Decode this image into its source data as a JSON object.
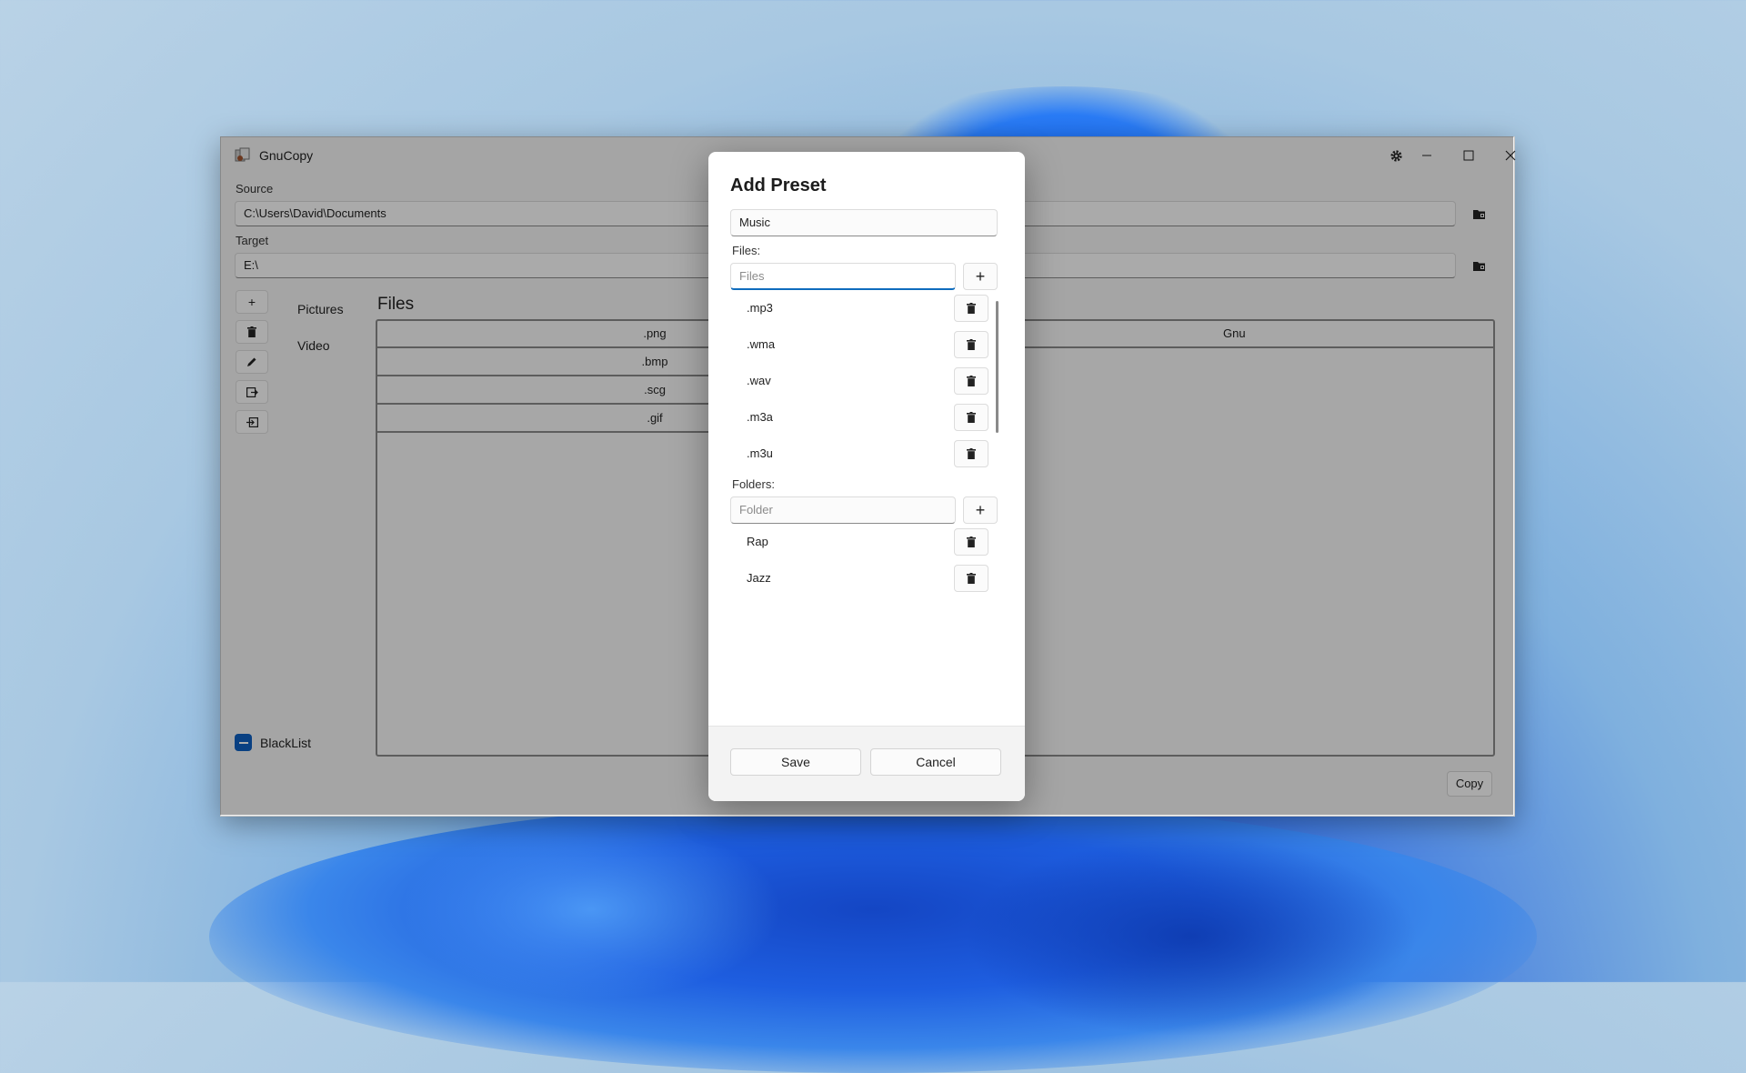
{
  "window": {
    "title": "GnuCopy",
    "source_label": "Source",
    "source_value": "C:\\Users\\David\\Documents",
    "target_label": "Target",
    "target_value": "E:\\",
    "presets": [
      "Pictures",
      "Video"
    ],
    "files_header": "Files",
    "grid_left_rows": [
      ".png",
      ".bmp",
      ".scg",
      ".gif"
    ],
    "grid_right_header": "Gnu",
    "blacklist_label": "BlackList",
    "copy_label": "Copy"
  },
  "dialog": {
    "title": "Add Preset",
    "name_value": "Music",
    "files_label": "Files:",
    "files_placeholder": "Files",
    "files": [
      ".mp3",
      ".wma",
      ".wav",
      ".m3a",
      ".m3u"
    ],
    "folders_label": "Folders:",
    "folder_placeholder": "Folder",
    "folders": [
      "Rap",
      "Jazz"
    ],
    "save_label": "Save",
    "cancel_label": "Cancel"
  },
  "colors": {
    "accent": "#0f6cbd",
    "checkbox": "#0e5fc0"
  },
  "icons": {
    "app": "gnucopy-app-icon",
    "settings": "gear-icon",
    "minimize": "minimize-icon",
    "maximize": "maximize-icon",
    "close": "close-icon",
    "folder_browse": "folder-open-icon",
    "add": "plus-icon",
    "delete": "trash-icon",
    "edit": "pencil-icon",
    "export": "export-icon",
    "import": "import-icon"
  }
}
